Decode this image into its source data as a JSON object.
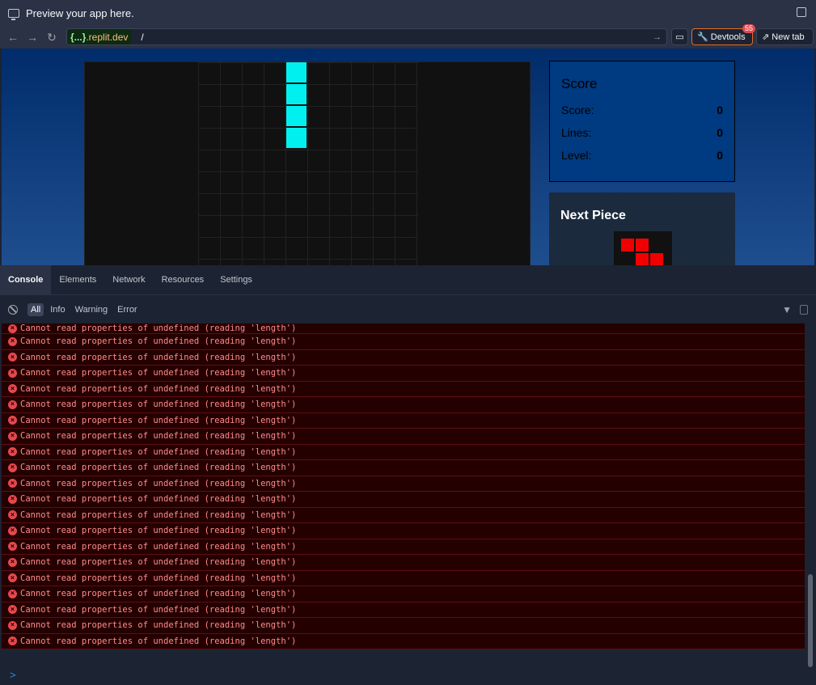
{
  "titlebar": {
    "title": "Preview your app here."
  },
  "urlbar": {
    "domain_prefix": "{...}",
    "domain_suffix": ".replit.dev",
    "path": "/",
    "devtools_label": "Devtools",
    "devtools_badge": "55",
    "new_tab_label": "New tab"
  },
  "game": {
    "score_title": "Score",
    "rows": [
      {
        "label": "Score:",
        "value": "0"
      },
      {
        "label": "Lines:",
        "value": "0"
      },
      {
        "label": "Level:",
        "value": "0"
      }
    ],
    "next_title": "Next Piece",
    "active_piece_color": "#00f0f0",
    "next_piece_color": "#f00000"
  },
  "devtools": {
    "tabs": [
      "Console",
      "Elements",
      "Network",
      "Resources",
      "Settings"
    ],
    "active_tab": "Console",
    "filters": [
      "All",
      "Info",
      "Warning",
      "Error"
    ],
    "active_filter": "All",
    "error_message": "Cannot read properties of undefined (reading 'length')",
    "log_count": 21,
    "prompt": ">"
  }
}
